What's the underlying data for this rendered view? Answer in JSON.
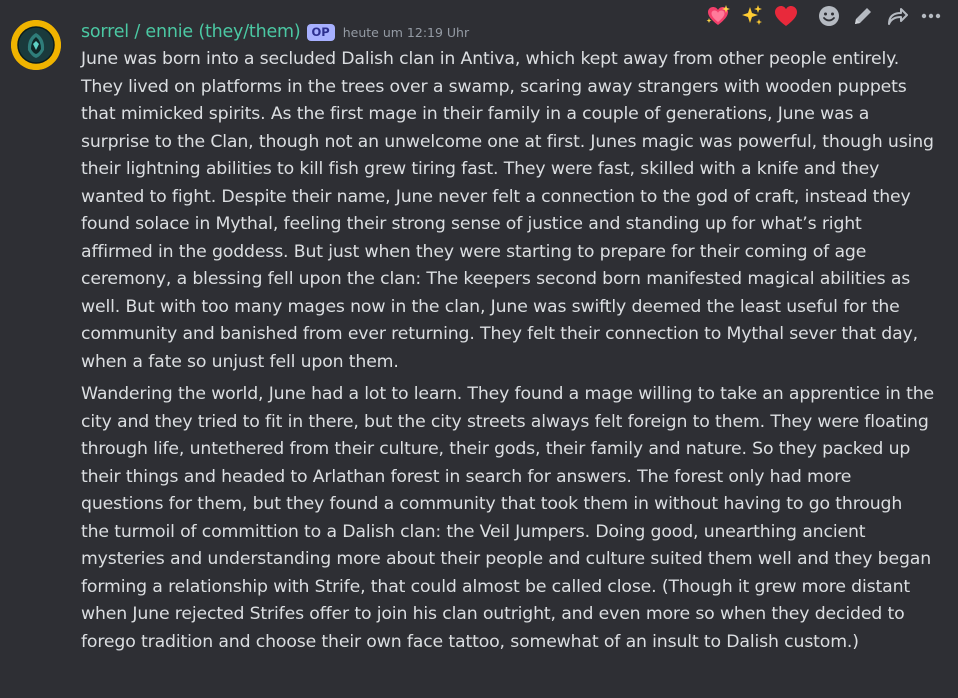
{
  "message": {
    "author": "sorrel / ennie (they/them)",
    "badge": "OP",
    "timestamp": "heute um 12:19 Uhr",
    "paragraphs": [
      "June was born into a secluded Dalish clan in Antiva, which kept away from other people entirely. They lived on platforms in the trees over a swamp, scaring away strangers with wooden puppets that mimicked spirits. As the first mage in their family in a couple of generations, June was a surprise to the Clan, though not an unwelcome one at first. Junes magic was powerful, though using their lightning abilities to kill fish grew tiring fast. They were fast, skilled with a knife and they wanted to fight. Despite their name, June never felt a connection to the god of craft, instead they found solace in Mythal, feeling their strong sense of justice and standing up for what’s right affirmed in the goddess. But just when they were starting to prepare for their coming of age ceremony, a blessing fell upon the clan: The keepers second born manifested magical abilities as well. But with too many mages now in the clan, June was swiftly deemed the least useful for the community and banished from ever returning. They felt their connection to Mythal sever that day, when a fate so unjust fell upon them.",
      "Wandering the world, June had a lot to learn. They found a mage willing to take an apprentice in the city and they tried to fit in there, but the city streets always felt foreign to them. They were floating through life, untethered from their culture, their gods, their family and nature. So they packed up their things and headed to Arlathan forest in search for answers. The forest only had more questions for them, but they found a community that took them in without having to go through the turmoil of committion to a Dalish clan: the Veil Jumpers. Doing good, unearthing ancient mysteries and understanding more about their people and culture suited them well and they began forming a relationship with Strife, that could almost be called close. (Though it grew more distant when June rejected Strifes offer to join his clan outright, and even more so when they decided to forego tradition and choose their own face tattoo, somewhat of an insult to Dalish custom.)"
    ]
  },
  "toolbar": {
    "reactions": [
      {
        "icon": "sparkling-heart-icon"
      },
      {
        "icon": "sparkles-icon"
      },
      {
        "icon": "red-heart-icon"
      }
    ],
    "actions": [
      {
        "icon": "add-reaction-icon"
      },
      {
        "icon": "edit-pencil-icon"
      },
      {
        "icon": "forward-arrow-icon"
      },
      {
        "icon": "more-options-icon"
      }
    ]
  },
  "colors": {
    "background": "#2e2f34",
    "username": "#4bc8a3",
    "text": "#dbdee1",
    "timestamp": "#949ba4",
    "badge_bg": "#a7b0ff",
    "avatar_bg": "#f0b400"
  }
}
